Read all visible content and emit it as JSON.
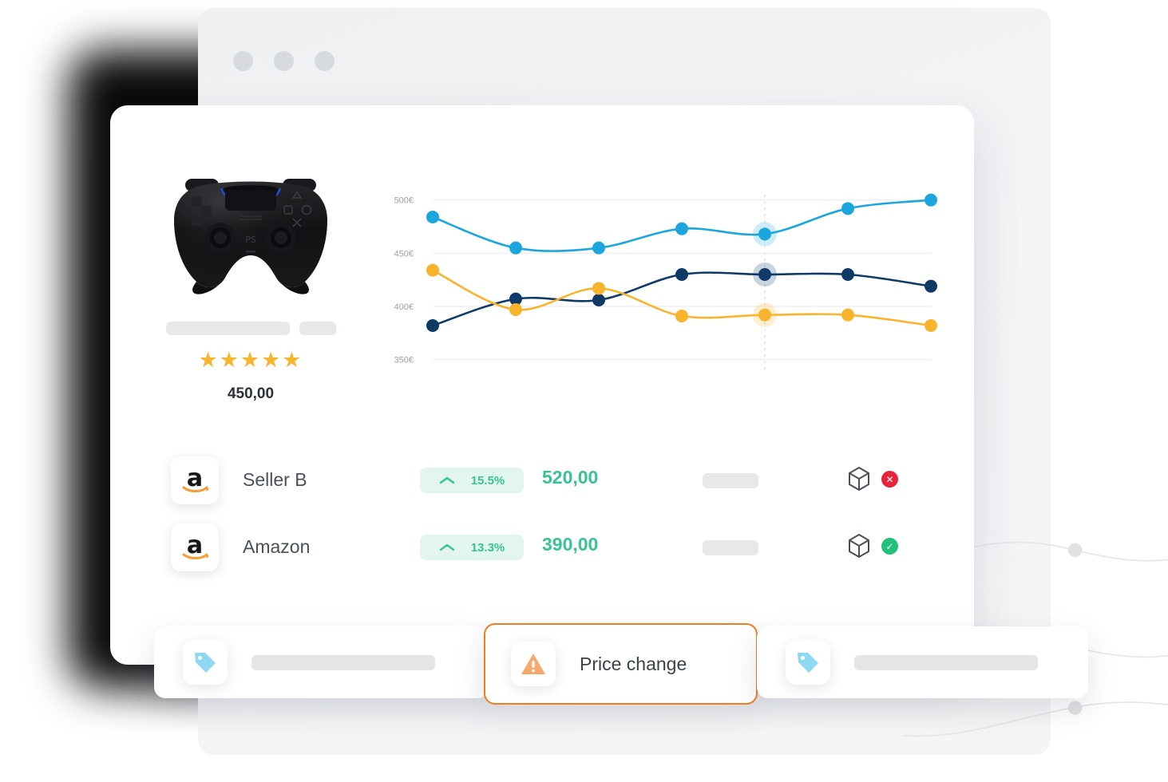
{
  "browser": {
    "traffic_lights": [
      "dot-1",
      "dot-2",
      "dot-3"
    ]
  },
  "product": {
    "image_alt": "ps5-dualsense-controller-black",
    "rating_stars": "★★★★★",
    "rating_value": 5,
    "price": "450,00"
  },
  "chart_data": {
    "type": "line",
    "title": "",
    "xlabel": "",
    "ylabel": "",
    "ylim": [
      340,
      505
    ],
    "ytick_labels": [
      "500€",
      "450€",
      "400€",
      "350€"
    ],
    "ytick_values": [
      500,
      450,
      400,
      350
    ],
    "grid": true,
    "legend_position": "none",
    "x": [
      1,
      2,
      3,
      4,
      5,
      6,
      7
    ],
    "highlight_index": 4,
    "series": [
      {
        "name": "series-blue",
        "color": "#1BA6DE",
        "values": [
          484,
          455,
          455,
          473,
          468,
          492,
          500
        ]
      },
      {
        "name": "series-navy",
        "color": "#0F3A68",
        "values": [
          382,
          407,
          406,
          430,
          430,
          430,
          419
        ]
      },
      {
        "name": "series-yellow",
        "color": "#F9B42D",
        "values": [
          434,
          397,
          417,
          391,
          392,
          392,
          382
        ]
      }
    ]
  },
  "sellers": {
    "rows": [
      {
        "logo": "amazon-logo",
        "name": "Seller B",
        "change_direction": "up",
        "change_percent": "15.5%",
        "price": "520,00",
        "stock_icon": "box-icon",
        "availability": "unavailable",
        "availability_symbol": "✕",
        "availability_color": "#e8243c"
      },
      {
        "logo": "amazon-logo",
        "name": "Amazon",
        "change_direction": "up",
        "change_percent": "13.3%",
        "price": "390,00",
        "stock_icon": "box-icon",
        "availability": "available",
        "availability_symbol": "✓",
        "availability_color": "#21c17a"
      }
    ]
  },
  "bottom_cards": [
    {
      "icon": "tag-icon",
      "label": ""
    },
    {
      "icon": "warning-icon",
      "label": "Price change"
    },
    {
      "icon": "tag-icon",
      "label": ""
    }
  ],
  "colors": {
    "blue": "#1BA6DE",
    "navy": "#0F3A68",
    "yellow": "#F9B42D",
    "green": "#3AC392",
    "green_badge_bg": "#E2F6EE",
    "orange_border": "#EF7E22",
    "red": "#E8243C"
  }
}
